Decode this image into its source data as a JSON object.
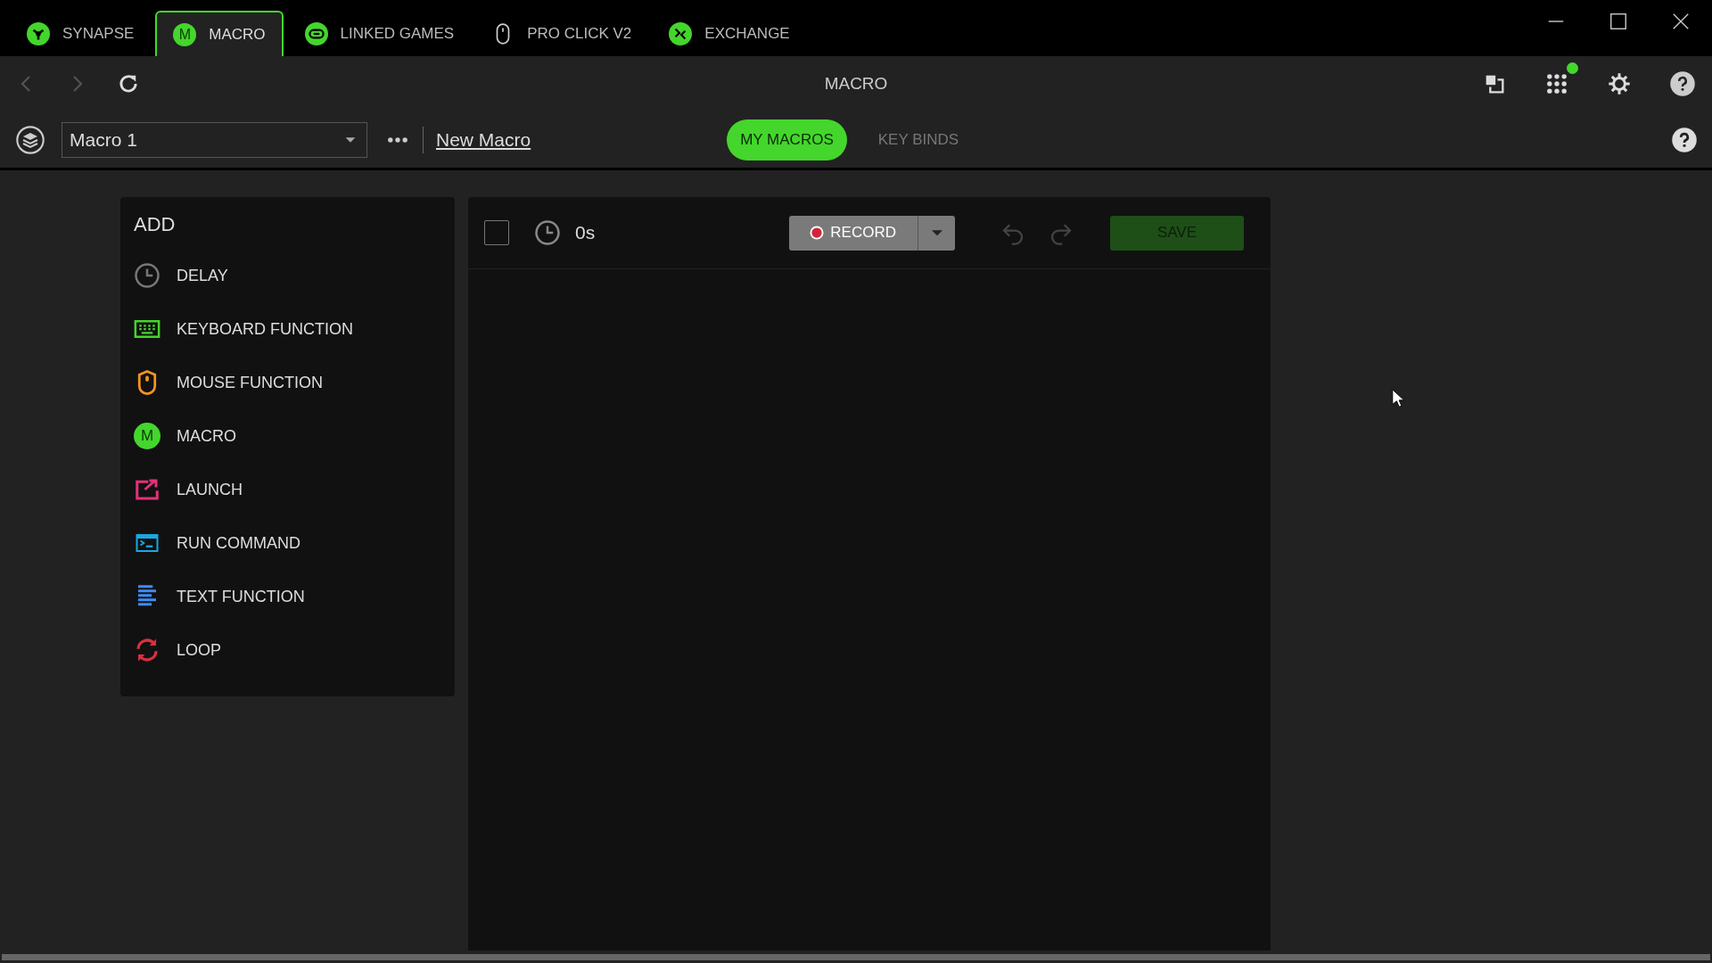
{
  "tabs": [
    {
      "kind": "synapse",
      "label": "SYNAPSE",
      "selected": false
    },
    {
      "kind": "macro",
      "label": "MACRO",
      "icon_text": "M",
      "selected": true
    },
    {
      "kind": "games",
      "label": "LINKED GAMES",
      "selected": false
    },
    {
      "kind": "mouse",
      "label": "PRO CLICK V2",
      "selected": false
    },
    {
      "kind": "exchange",
      "label": "EXCHANGE",
      "selected": false
    }
  ],
  "nav": {
    "title": "MACRO",
    "apps_notification": true
  },
  "toolbar": {
    "macro_select": "Macro 1",
    "new_macro_link": "New Macro",
    "views": [
      {
        "label": "MY MACROS",
        "selected": true
      },
      {
        "label": "KEY BINDS",
        "selected": false
      }
    ]
  },
  "add_panel": {
    "title": "ADD",
    "items": [
      {
        "kind": "delay",
        "label": "DELAY"
      },
      {
        "kind": "keyboard",
        "label": "KEYBOARD FUNCTION"
      },
      {
        "kind": "mouse",
        "label": "MOUSE FUNCTION"
      },
      {
        "kind": "macro",
        "label": "MACRO",
        "icon_text": "M"
      },
      {
        "kind": "launch",
        "label": "LAUNCH"
      },
      {
        "kind": "command",
        "label": "RUN COMMAND"
      },
      {
        "kind": "text",
        "label": "TEXT FUNCTION"
      },
      {
        "kind": "loop",
        "label": "LOOP"
      }
    ]
  },
  "editor": {
    "select_all_checked": false,
    "duration": "0s",
    "record_button": "RECORD",
    "undo_disabled": true,
    "redo_disabled": true,
    "save_button": "SAVE",
    "save_disabled": true
  }
}
